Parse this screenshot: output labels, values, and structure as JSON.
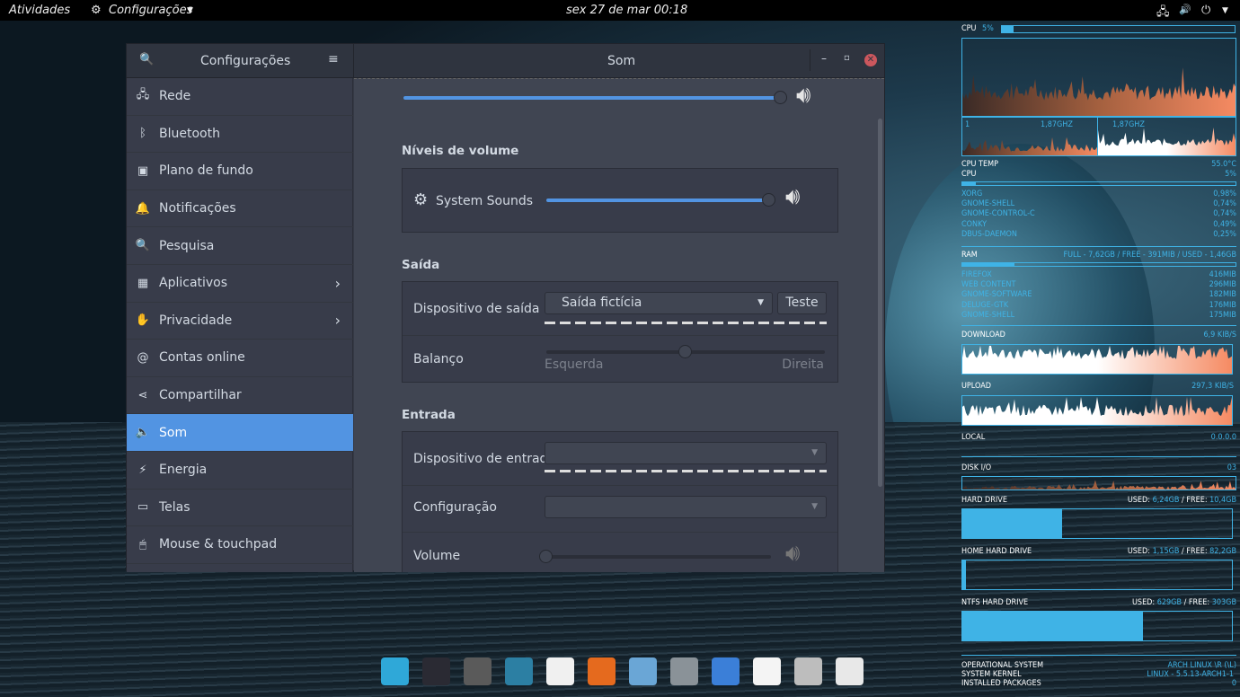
{
  "topbar": {
    "activities": "Atividades",
    "app_menu": "Configurações",
    "clock": "sex 27 de mar  00:18"
  },
  "window": {
    "sidebar_title": "Configurações",
    "title": "Som"
  },
  "sidebar": {
    "items": [
      {
        "label": "Rede",
        "icon": "network-icon"
      },
      {
        "label": "Bluetooth",
        "icon": "bluetooth-icon"
      },
      {
        "label": "Plano de fundo",
        "icon": "background-icon"
      },
      {
        "label": "Notificações",
        "icon": "bell-icon"
      },
      {
        "label": "Pesquisa",
        "icon": "search-icon"
      },
      {
        "label": "Aplicativos",
        "icon": "apps-icon"
      },
      {
        "label": "Privacidade",
        "icon": "hand-icon"
      },
      {
        "label": "Contas online",
        "icon": "at-icon"
      },
      {
        "label": "Compartilhar",
        "icon": "share-icon"
      },
      {
        "label": "Som",
        "icon": "speaker-icon"
      },
      {
        "label": "Energia",
        "icon": "power-icon"
      },
      {
        "label": "Telas",
        "icon": "display-icon"
      },
      {
        "label": "Mouse & touchpad",
        "icon": "mouse-icon"
      }
    ],
    "active": "Som"
  },
  "sound": {
    "output_volume_percent": 100,
    "levels_heading": "Níveis de volume",
    "system_sounds": {
      "label": "System Sounds",
      "percent": 100
    },
    "output_heading": "Saída",
    "output_device_label": "Dispositivo de saída",
    "output_device_value": "Saída fictícia",
    "test_button": "Teste",
    "balance_label": "Balanço",
    "balance_left": "Esquerda",
    "balance_right": "Direita",
    "balance_percent": 50,
    "input_heading": "Entrada",
    "input_device_label": "Dispositivo de entrada",
    "config_label": "Configuração",
    "input_volume_label": "Volume",
    "input_volume_percent": 0
  },
  "conky": {
    "cpu_label": "CPU",
    "cpu_value": "5%",
    "cpu_percent": 5,
    "core1_label": "1",
    "core1_freq": "1,87GHz",
    "core2_freq": "1,87GHz",
    "cpu_temp_label": "CPU TEMP",
    "cpu_temp": "55.0°C",
    "cpu2_label": "CPU",
    "cpu2_value": "5%",
    "processes": [
      {
        "name": "xorg",
        "value": "0,98%"
      },
      {
        "name": "gnome-shell",
        "value": "0,74%"
      },
      {
        "name": "gnome-control-c",
        "value": "0,74%"
      },
      {
        "name": "conky",
        "value": "0,49%"
      },
      {
        "name": "dbus-daemon",
        "value": "0,25%"
      }
    ],
    "ram_label": "RAM",
    "ram_value": "FULL - 7,62GB / FREE - 391MiB / USED - 1,46GB",
    "ram_percent": 19,
    "ram_processes": [
      {
        "name": "firefox",
        "value": "416MiB"
      },
      {
        "name": "web content",
        "value": "296MiB"
      },
      {
        "name": "gnome-software",
        "value": "182MiB"
      },
      {
        "name": "deluge-gtk",
        "value": "176MiB"
      },
      {
        "name": "gnome-shell",
        "value": "175MiB"
      }
    ],
    "download_label": "DOWNLOAD",
    "download_value": "6,9 KiB/s",
    "upload_label": "UPLOAD",
    "upload_value": "297,3 KiB/s",
    "local_label": "LOCAL",
    "local_value": "0.0.0.0",
    "diskio_label": "DISK I/O",
    "diskio_value": "03",
    "drives": [
      {
        "label": "HARD DRIVE",
        "used_label": "USED:",
        "used": "6,24GB",
        "free_label": "/ FREE:",
        "free": "10,4GB",
        "percent": 37
      },
      {
        "label": "HOME HARD DRIVE",
        "used_label": "USED:",
        "used": "1,15GB",
        "free_label": "/ FREE:",
        "free": "82,2GB",
        "percent": 1.4
      },
      {
        "label": "NTFS HARD DRIVE",
        "used_label": "USED:",
        "used": "629GB",
        "free_label": "/ FREE:",
        "free": "303GB",
        "percent": 67
      }
    ],
    "os_label": "OPERATIONAL SYSTEM",
    "os_value": "ARCH LINUX \\r (\\l)",
    "kernel_label": "SYSTEM KERNEL",
    "kernel_value": "LINUX - 5.5.13-ARCH1-1",
    "packages_label": "INSTALLED PACKAGES",
    "packages_value": "0"
  },
  "dock": [
    {
      "name": "system-monitor",
      "color": "#2fa8d8"
    },
    {
      "name": "terminal",
      "color": "#2a2a33"
    },
    {
      "name": "rhythmbox",
      "color": "#5a5a5a"
    },
    {
      "name": "disk-usage",
      "color": "#2c7fa3"
    },
    {
      "name": "thunderbird",
      "color": "#f0f0f0"
    },
    {
      "name": "firefox",
      "color": "#e56a1e"
    },
    {
      "name": "chromium",
      "color": "#6aa6d6"
    },
    {
      "name": "ink",
      "color": "#8a9298"
    },
    {
      "name": "file-cabinet",
      "color": "#3b7fd8"
    },
    {
      "name": "text-editor",
      "color": "#f4f4f4"
    },
    {
      "name": "trash",
      "color": "#bdbdbd"
    },
    {
      "name": "settings",
      "color": "#e8e8e8"
    }
  ]
}
